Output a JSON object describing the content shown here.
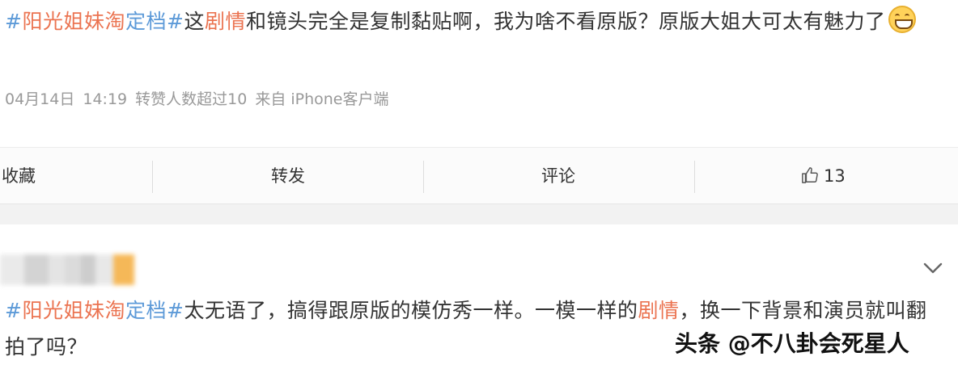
{
  "post": {
    "tag_hash_open": "#",
    "tag_part1": "阳光姐妹淘",
    "tag_part2": "定档",
    "tag_hash_close": "#",
    "text_before_kw": "这",
    "keyword": "剧情",
    "text_after_kw": "和镜头完全是复制黏贴啊，我为啥不看原版？原版大姐大可太有魅力了",
    "emoji": "grin-emoji",
    "meta": {
      "date": "04月14日",
      "time": "14:19",
      "reposts": "转赞人数超过10",
      "source_prefix": "来自",
      "source": "iPhone客户端"
    }
  },
  "actions": {
    "favorite": "收藏",
    "repost": "转发",
    "comment": "评论",
    "like_count": "13"
  },
  "comment": {
    "tag_hash_open": "#",
    "tag_part1": "阳光姐妹淘",
    "tag_part2": "定档",
    "tag_hash_close": "#",
    "text1": "太无语了，搞得跟原版的模仿秀一样。一模一样的",
    "keyword": "剧情",
    "text2": "，换一下背景和演员就叫翻拍了吗？"
  },
  "watermark": "头条 @不八卦会死星人",
  "colors": {
    "tag_blue": "#5d9ad8",
    "keyword_orange": "#eb7350",
    "meta_gray": "#999999"
  }
}
